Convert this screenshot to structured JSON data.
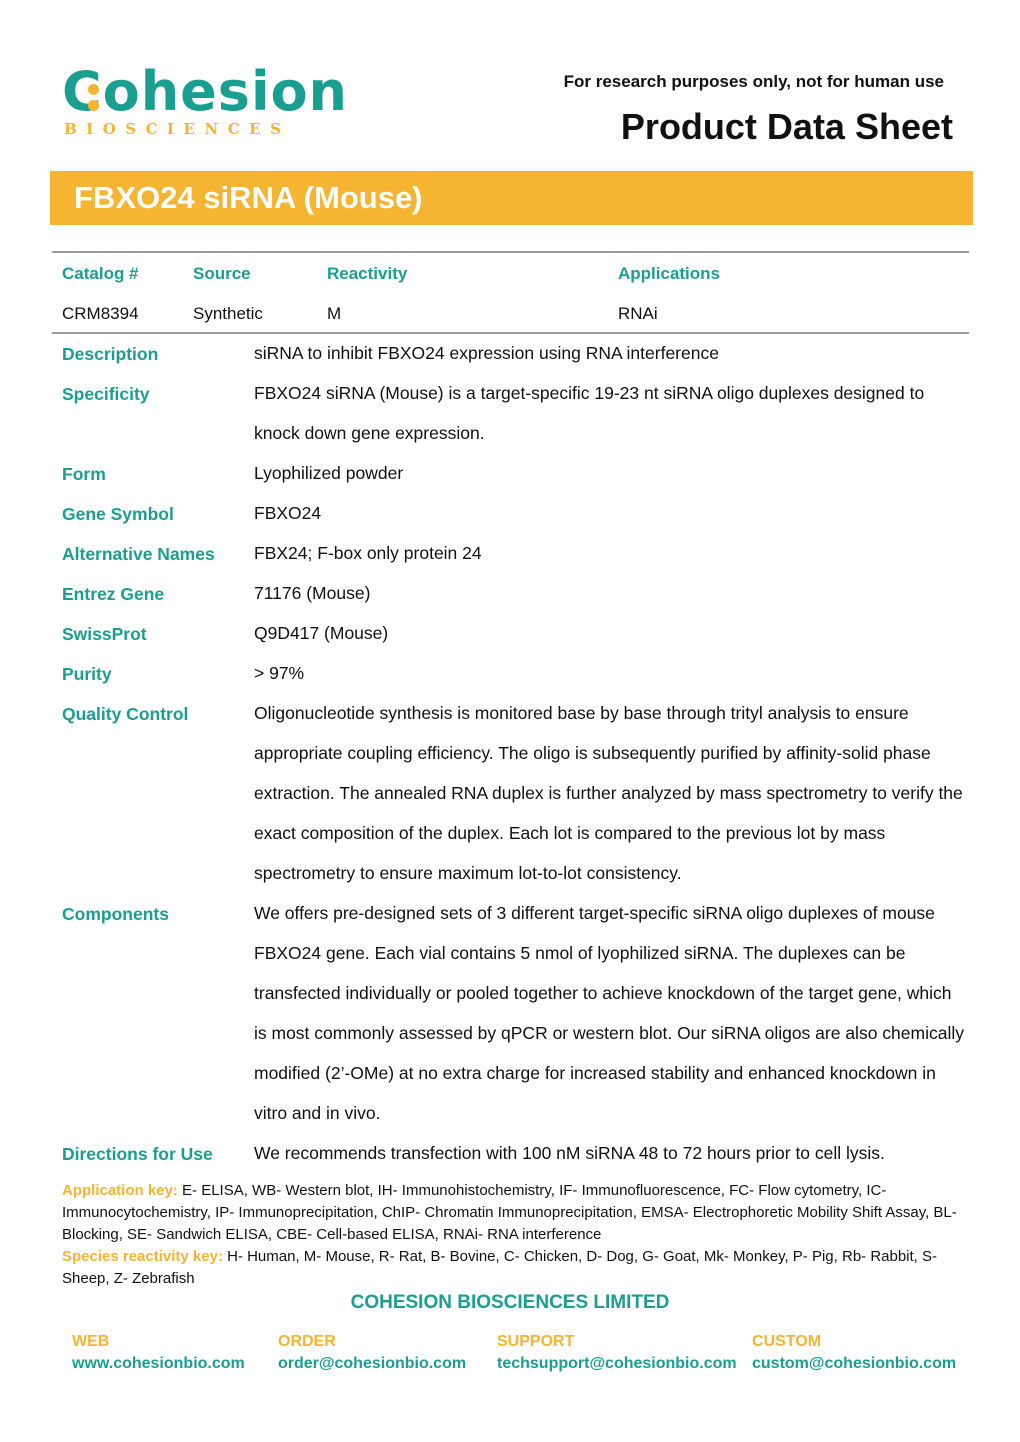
{
  "header": {
    "logo_word": "Cohesion",
    "logo_sub": "BIOSCIENCES",
    "disclaimer": "For research purposes only, not for human use",
    "doc_title": "Product Data Sheet"
  },
  "product_title": "FBXO24 siRNA (Mouse)",
  "summary_table": {
    "headers": [
      "Catalog #",
      "Source",
      "Reactivity",
      "Applications"
    ],
    "values": [
      "CRM8394",
      "Synthetic",
      "M",
      "RNAi"
    ]
  },
  "details": [
    {
      "label": "Description",
      "value": "siRNA to inhibit FBXO24 expression using RNA interference"
    },
    {
      "label": "Specificity",
      "value": "FBXO24 siRNA (Mouse) is a target-specific 19-23 nt siRNA oligo duplexes designed to knock down gene expression."
    },
    {
      "label": "Form",
      "value": "Lyophilized powder"
    },
    {
      "label": "Gene Symbol",
      "value": "FBXO24"
    },
    {
      "label": "Alternative Names",
      "value": "FBX24; F-box only protein 24"
    },
    {
      "label": "Entrez Gene",
      "value": "71176 (Mouse)"
    },
    {
      "label": "SwissProt",
      "value": "Q9D417 (Mouse)"
    },
    {
      "label": "Purity",
      "value": "> 97%"
    },
    {
      "label": "Quality Control",
      "value": "Oligonucleotide synthesis is monitored base by base through trityl analysis to ensure appropriate coupling efficiency. The oligo is subsequently purified by affinity-solid phase extraction. The annealed RNA duplex is further analyzed by mass spectrometry to verify the exact composition of the duplex. Each lot is compared to the previous lot by mass spectrometry to ensure maximum lot-to-lot consistency."
    },
    {
      "label": "Components",
      "value": "We offers pre-designed sets of 3 different target-specific siRNA oligo duplexes of mouse FBXO24 gene. Each vial contains 5 nmol of lyophilized siRNA. The duplexes can be transfected individually or pooled together to achieve knockdown of the target gene, which is most commonly assessed by qPCR or western blot. Our siRNA oligos are also chemically modified (2’-OMe) at no extra charge for increased stability and enhanced knockdown in vitro and in vivo."
    },
    {
      "label": "Directions for Use",
      "value": "We recommends transfection with 100 nM siRNA 48 to 72 hours prior to cell lysis."
    }
  ],
  "keys": {
    "application_label": "Application key:",
    "application_text": " E- ELISA, WB- Western blot, IH- Immunohistochemistry, IF- Immunofluorescence, FC- Flow cytometry, IC- Immunocytochemistry, IP- Immunoprecipitation, ChIP- Chromatin Immunoprecipitation, EMSA- Electrophoretic Mobility Shift Assay, BL- Blocking, SE- Sandwich ELISA, CBE- Cell-based ELISA, RNAi- RNA interference",
    "species_label": "Species reactivity key:",
    "species_text": " H- Human, M- Mouse, R- Rat, B- Bovine, C- Chicken, D- Dog, G- Goat, Mk- Monkey, P- Pig, Rb- Rabbit, S- Sheep, Z- Zebrafish"
  },
  "footer": {
    "company": "COHESION BIOSCIENCES LIMITED",
    "contacts": [
      {
        "label": "WEB",
        "value": "www.cohesionbio.com"
      },
      {
        "label": "ORDER",
        "value": "order@cohesionbio.com"
      },
      {
        "label": "SUPPORT",
        "value": "techsupport@cohesionbio.com"
      },
      {
        "label": "CUSTOM",
        "value": "custom@cohesionbio.com"
      }
    ]
  },
  "colors": {
    "brand_teal": "#1a9e90",
    "brand_gold": "#f5b532"
  }
}
